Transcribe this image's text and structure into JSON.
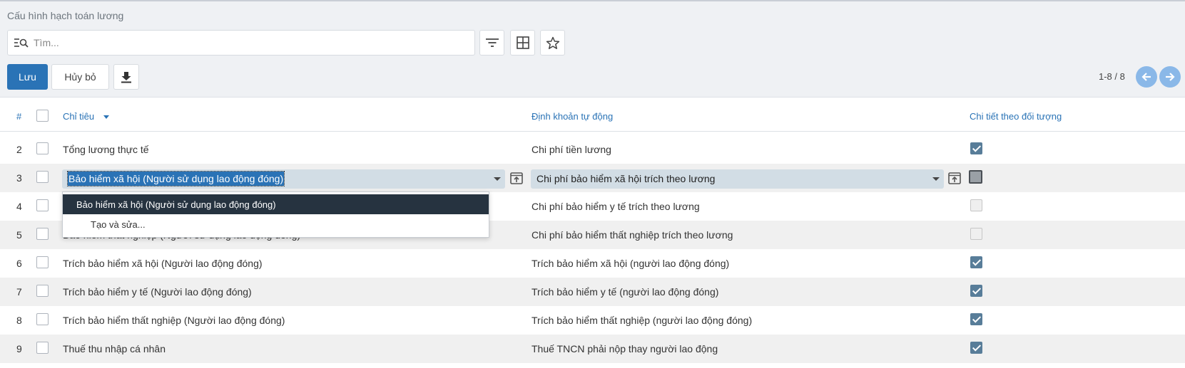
{
  "breadcrumb": "Cấu hình hạch toán lương",
  "search": {
    "placeholder": "Tìm..."
  },
  "toolbar": {
    "save_label": "Lưu",
    "cancel_label": "Hủy bỏ"
  },
  "pager": {
    "text": "1-8 / 8"
  },
  "columns": {
    "num": "#",
    "criterion": "Chỉ tiêu",
    "auto_account": "Định khoản tự động",
    "detail_by_object": "Chi tiết theo đối tượng"
  },
  "rows": [
    {
      "num": "2",
      "criterion": "Tổng lương thực tế",
      "account": "Chi phí tiền lương",
      "detail": true
    },
    {
      "num": "3",
      "criterion": "Bảo hiểm xã hội (Người sử dụng lao động đóng)",
      "account": "Chi phí bảo hiểm xã hội trích theo lương",
      "detail": false
    },
    {
      "num": "4",
      "criterion": "",
      "account": "Chi phí bảo hiểm y tế trích theo lương",
      "detail": false
    },
    {
      "num": "5",
      "criterion": "Bảo hiểm thất nghiệp (Người sử dụng lao động đóng)",
      "account": "Chi phí bảo hiểm thất nghiệp trích theo lương",
      "detail": false
    },
    {
      "num": "6",
      "criterion": "Trích bảo hiểm xã hội (Người lao động đóng)",
      "account": "Trích bảo hiểm xã hội (người lao động đóng)",
      "detail": true
    },
    {
      "num": "7",
      "criterion": "Trích bảo hiểm y tế (Người lao động đóng)",
      "account": "Trích bảo hiểm y tế (người lao động đóng)",
      "detail": true
    },
    {
      "num": "8",
      "criterion": "Trích bảo hiểm thất nghiệp (Người lao động đóng)",
      "account": "Trích bảo hiểm thất nghiệp (người lao động đóng)",
      "detail": true
    },
    {
      "num": "9",
      "criterion": "Thuế thu nhập cá nhân",
      "account": "Thuế TNCN phải nộp thay người lao động",
      "detail": true
    }
  ],
  "dropdown": {
    "options": [
      "Bảo hiểm xã hội (Người sử dụng lao động đóng)"
    ],
    "create_label": "Tạo và sửa..."
  },
  "colors": {
    "accent": "#2a73b6",
    "dropdown_selected": "#263340",
    "checkbox": "#587d99"
  }
}
